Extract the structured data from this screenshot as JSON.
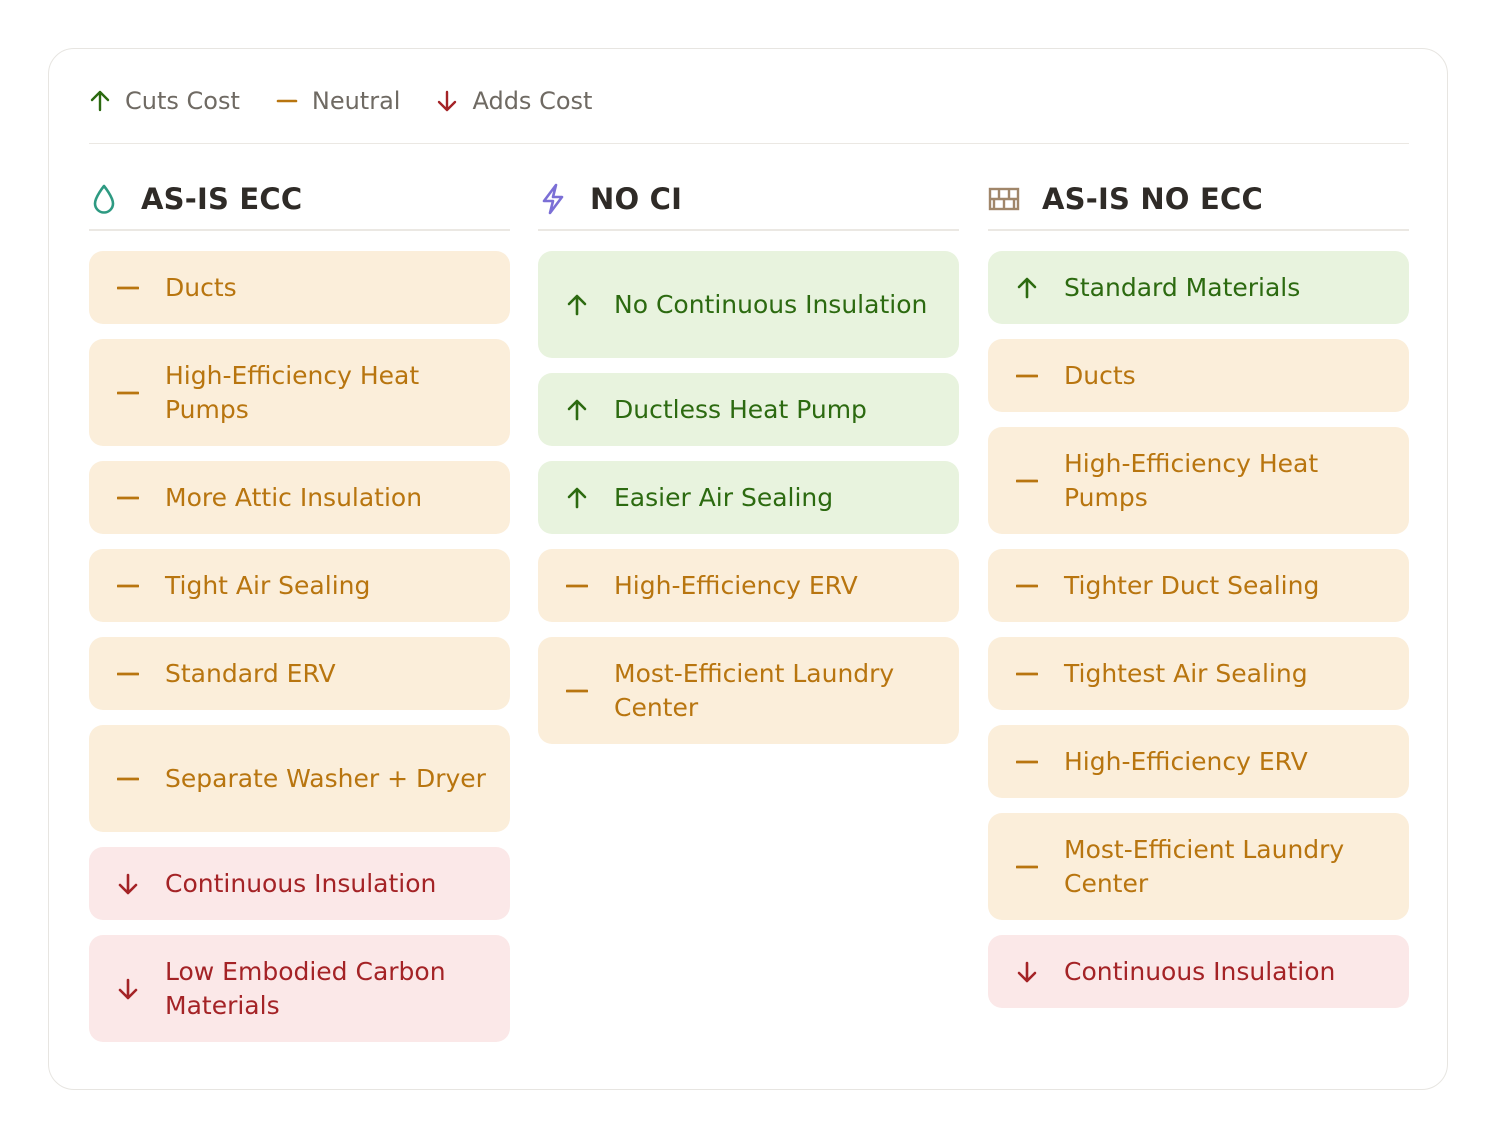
{
  "legend": {
    "cut": "Cuts Cost",
    "neutral": "Neutral",
    "adds": "Adds Cost"
  },
  "colors": {
    "cut": "#2c6a10",
    "neutral": "#b8750f",
    "adds": "#a42326",
    "cut_bg": "#e8f3de",
    "neutral_bg": "#fbeeda",
    "adds_bg": "#fbe8e8"
  },
  "columns": [
    {
      "title": "AS-IS ECC",
      "icon": "droplet-icon",
      "icon_color": "#2e9a82",
      "items": [
        {
          "label": "Ducts",
          "impact": "neutral"
        },
        {
          "label": "High-Efficiency Heat Pumps",
          "impact": "neutral"
        },
        {
          "label": "More Attic Insulation",
          "impact": "neutral"
        },
        {
          "label": "Tight Air Sealing",
          "impact": "neutral"
        },
        {
          "label": "Standard ERV",
          "impact": "neutral"
        },
        {
          "label": "Separate Washer + Dryer",
          "impact": "neutral"
        },
        {
          "label": "Continuous Insulation",
          "impact": "adds"
        },
        {
          "label": "Low Embodied Carbon Materials",
          "impact": "adds"
        }
      ]
    },
    {
      "title": "NO CI",
      "icon": "lightning-icon",
      "icon_color": "#7b6fd6",
      "items": [
        {
          "label": "No Continuous Insulation",
          "impact": "cut"
        },
        {
          "label": "Ductless Heat Pump",
          "impact": "cut"
        },
        {
          "label": "Easier Air Sealing",
          "impact": "cut"
        },
        {
          "label": "High-Efficiency ERV",
          "impact": "neutral"
        },
        {
          "label": "Most-Efficient Laundry Center",
          "impact": "neutral"
        }
      ]
    },
    {
      "title": "AS-IS NO ECC",
      "icon": "brick-wall-icon",
      "icon_color": "#a0866a",
      "items": [
        {
          "label": "Standard Materials",
          "impact": "cut"
        },
        {
          "label": "Ducts",
          "impact": "neutral"
        },
        {
          "label": "High-Efficiency Heat Pumps",
          "impact": "neutral"
        },
        {
          "label": "Tighter Duct Sealing",
          "impact": "neutral"
        },
        {
          "label": "Tightest Air Sealing",
          "impact": "neutral"
        },
        {
          "label": "High-Efficiency ERV",
          "impact": "neutral"
        },
        {
          "label": "Most-Efficient Laundry Center",
          "impact": "neutral"
        },
        {
          "label": "Continuous Insulation",
          "impact": "adds"
        }
      ]
    }
  ]
}
